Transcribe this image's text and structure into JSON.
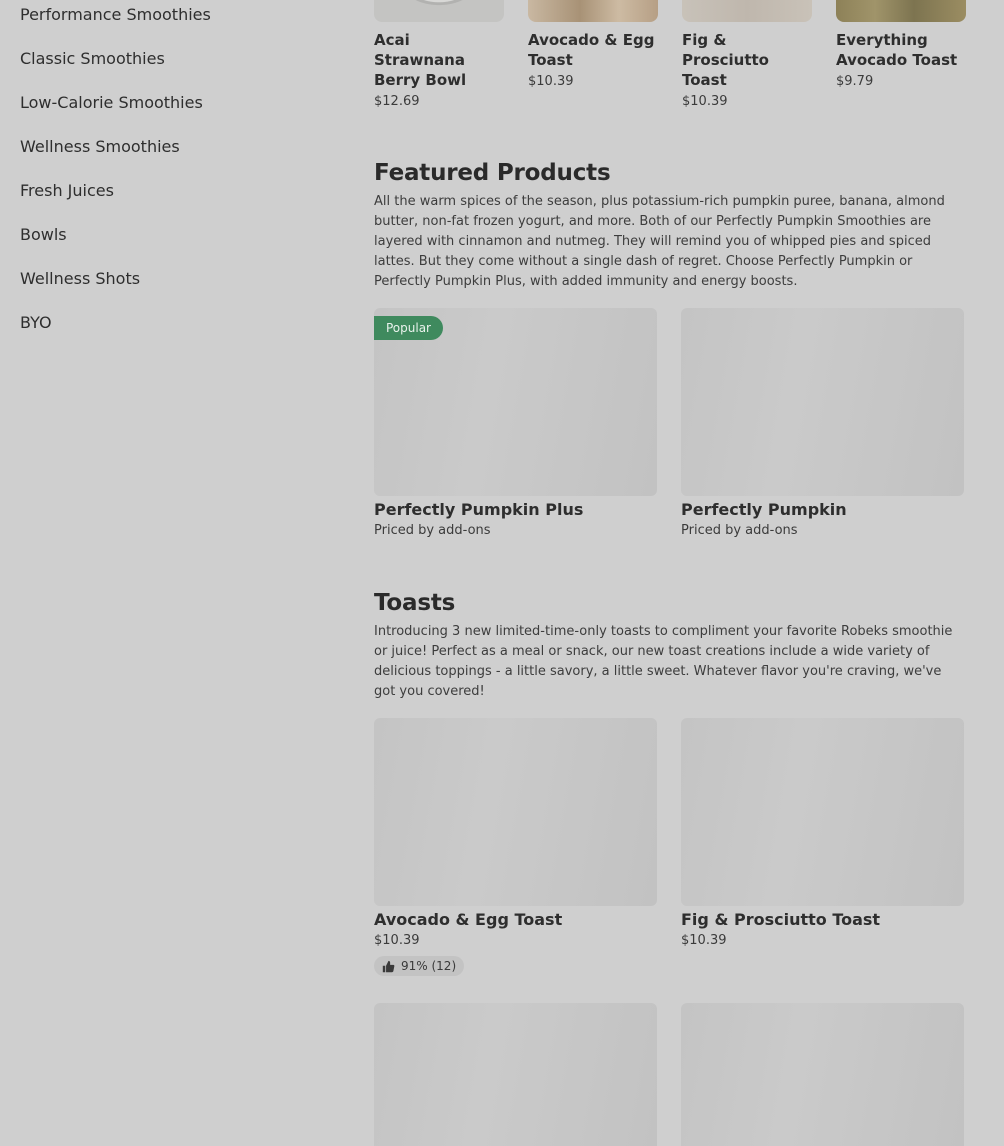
{
  "sidebar": {
    "items": [
      {
        "label": "Performance Smoothies"
      },
      {
        "label": "Classic Smoothies"
      },
      {
        "label": "Low-Calorie Smoothies"
      },
      {
        "label": "Wellness Smoothies"
      },
      {
        "label": "Fresh Juices"
      },
      {
        "label": "Bowls"
      },
      {
        "label": "Wellness Shots"
      },
      {
        "label": "BYO"
      }
    ]
  },
  "carousel": {
    "items": [
      {
        "name": "Acai Strawnana Berry Bowl",
        "price": "$12.69"
      },
      {
        "name": "Avocado & Egg Toast",
        "price": "$10.39"
      },
      {
        "name": "Fig & Prosciutto Toast",
        "price": "$10.39"
      },
      {
        "name": "Everything Avocado Toast",
        "price": "$9.79"
      }
    ]
  },
  "featured": {
    "title": "Featured Products",
    "description": "All the warm spices of the season, plus potassium-rich pumpkin puree, banana, almond butter, non-fat frozen yogurt, and more. Both of our Perfectly Pumpkin Smoothies are layered with cinnamon and nutmeg. They will remind you of whipped pies and spiced lattes. But they come without a single dash of regret. Choose Perfectly Pumpkin or Perfectly Pumpkin Plus, with added immunity and energy boosts.",
    "items": [
      {
        "name": "Perfectly Pumpkin Plus",
        "price": "Priced by add-ons",
        "badge": "Popular"
      },
      {
        "name": "Perfectly Pumpkin",
        "price": "Priced by add-ons"
      }
    ]
  },
  "toasts": {
    "title": "Toasts",
    "description": "Introducing 3 new limited-time-only toasts to compliment your favorite Robeks smoothie or juice! Perfect as a meal or snack, our new toast creations include a wide variety of delicious toppings - a little savory, a little sweet. Whatever flavor you're craving, we've got you covered!",
    "items": [
      {
        "name": "Avocado & Egg Toast",
        "price": "$10.39",
        "rating": "91% (12)"
      },
      {
        "name": "Fig & Prosciutto Toast",
        "price": "$10.39"
      }
    ]
  },
  "colors": {
    "badge": "#3f8a5e",
    "overlay_background": "#cfcfcf"
  },
  "icons": {
    "rating": "thumbs-up-icon"
  }
}
